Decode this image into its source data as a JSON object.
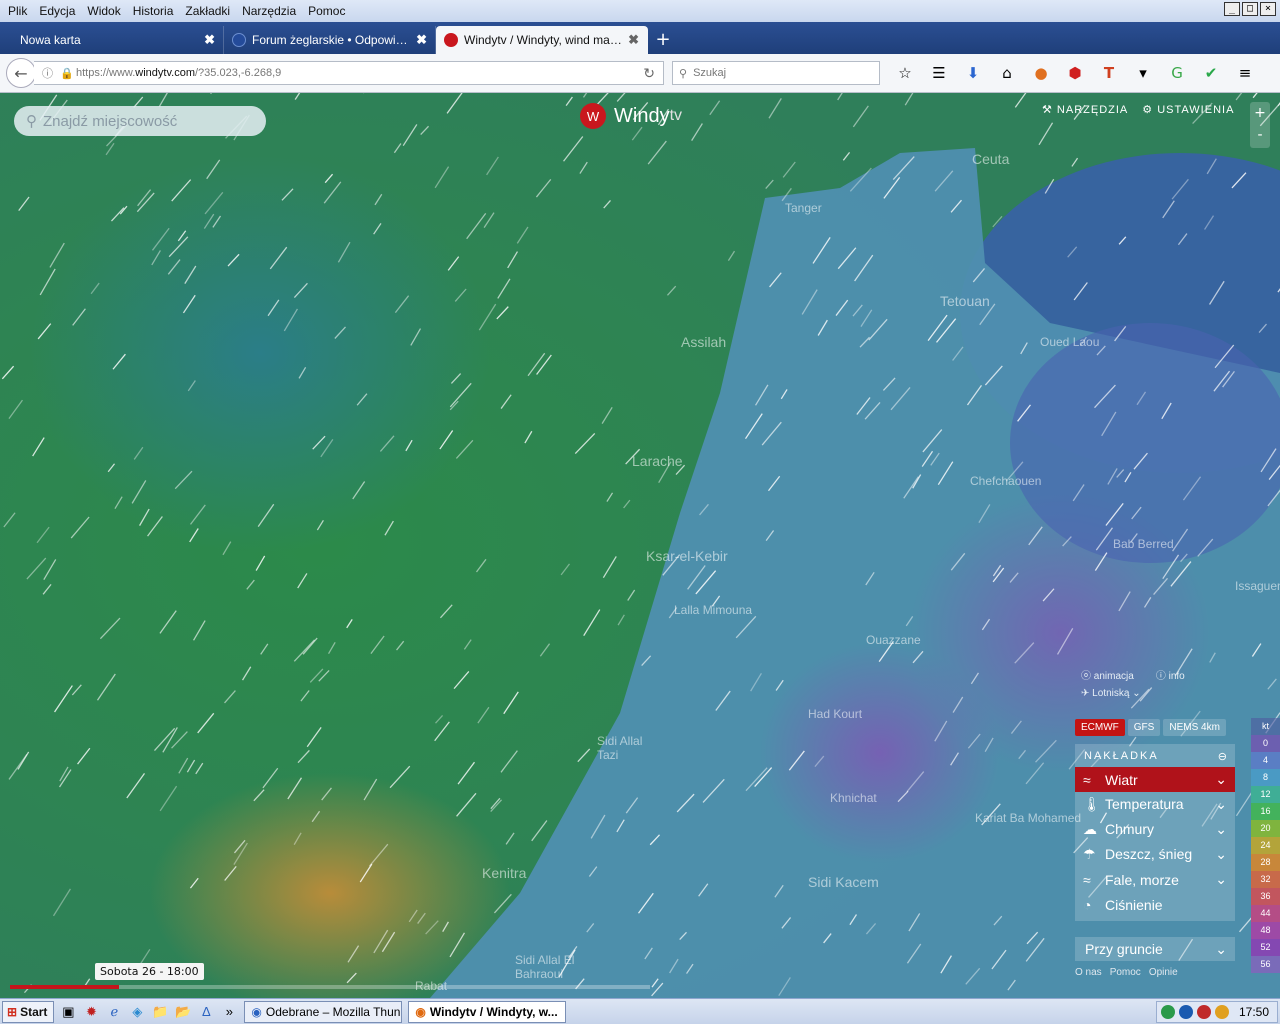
{
  "menubar": {
    "items": [
      "Plik",
      "Edycja",
      "Widok",
      "Historia",
      "Zakładki",
      "Narzędzia",
      "Pomoc"
    ]
  },
  "window_controls": [
    "_",
    "□",
    "×"
  ],
  "tabs": [
    {
      "label": "Nowa karta",
      "close": "✖"
    },
    {
      "label": "Forum żeglarskie • Odpowiedz",
      "close": "✖"
    },
    {
      "label": "Windytv / Windyty, wind map...",
      "close": "✖"
    }
  ],
  "nav": {
    "url_prefix": "https://www.",
    "url_host": "windytv.com",
    "url_path": "/?35.023,-6.268,9",
    "search_placeholder": "Szukaj"
  },
  "map": {
    "search_placeholder": "Znajdź miejscowość",
    "logo": "Windy",
    "logo_suffix": "tv",
    "tools_label": "NARZĘDZIA",
    "settings_label": "USTAWIENIA",
    "zoom_in": "+",
    "zoom_out": "-",
    "places": [
      "Tanger",
      "Ceuta",
      "Tetouan",
      "Oued Laou",
      "Assilah",
      "Larache",
      "Chefchaouen",
      "Ksar-el-Kebir",
      "Bab Berred",
      "Lalla Mimouna",
      "Ouazzane",
      "Issaguen",
      "Had Kourt",
      "Sidi Allal Tazi",
      "Khnichat",
      "Kenitra",
      "Sidi Kacem",
      "Kariat Ba Mohamed",
      "Sidi Allal El Bahraoui",
      "Rabat"
    ]
  },
  "panel": {
    "animation": "animacja",
    "info": "info",
    "aviation": "Lotniską",
    "models": [
      "ECMWF",
      "GFS",
      "NEMS 4km"
    ],
    "overlay_header": "NAKŁADKA",
    "overlays": [
      {
        "label": "Wiatr",
        "icon": "wind-icon"
      },
      {
        "label": "Temperatura",
        "icon": "thermometer-icon"
      },
      {
        "label": "Chmury",
        "icon": "cloud-icon"
      },
      {
        "label": "Deszcz, śnieg",
        "icon": "rain-icon"
      },
      {
        "label": "Fale, morze",
        "icon": "waves-icon"
      },
      {
        "label": "Ciśnienie",
        "icon": "pressure-icon"
      }
    ],
    "ground": "Przy gruncie",
    "footer": [
      "O nas",
      "Pomoc",
      "Opinie"
    ]
  },
  "scale": {
    "unit": "kt",
    "values": [
      "0",
      "4",
      "8",
      "12",
      "16",
      "20",
      "24",
      "28",
      "32",
      "36",
      "44",
      "48",
      "52",
      "56"
    ],
    "colors": [
      "#6c5fb0",
      "#5a7ec4",
      "#4a9ac4",
      "#3fae96",
      "#43b25c",
      "#7fb43e",
      "#b3a43a",
      "#c8873a",
      "#c86a4a",
      "#c2565e",
      "#b44d86",
      "#9d4aa6",
      "#8448b2",
      "#7a6bb9"
    ]
  },
  "timeline": {
    "label": "Sobota 26 - 18:00",
    "progress": 0.17
  },
  "taskbar": {
    "start": "Start",
    "tasks": [
      "Odebrane – Mozilla Thun...",
      "Windytv / Windyty, w..."
    ],
    "clock": "17:50"
  }
}
